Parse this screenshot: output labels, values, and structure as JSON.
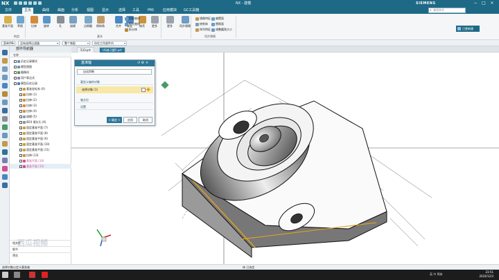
{
  "titlebar": {
    "logo": "NX",
    "title": "NX - 建模",
    "brand": "SIEMENS"
  },
  "menu_tabs": [
    "文件",
    "主页",
    "曲线",
    "曲面",
    "分析",
    "视图",
    "显示",
    "选择",
    "工具",
    "PMI",
    "应用模块",
    "GC工具箱"
  ],
  "search": {
    "placeholder": "查找命令"
  },
  "ribbon": {
    "buttons": [
      {
        "label": "基准平面",
        "color": "#d9b14a"
      },
      {
        "label": "草图",
        "color": "#6fa4cf"
      },
      {
        "label": "拉伸",
        "color": "#d48a3c"
      },
      {
        "label": "旋转",
        "color": "#5b95c8"
      },
      {
        "label": "孔",
        "color": "#8a8f96"
      },
      {
        "label": "拔模",
        "color": "#7a9fc0"
      },
      {
        "label": "边倒圆",
        "color": "#7aa8c8"
      },
      {
        "label": "倒斜角",
        "color": "#c29a6a"
      },
      {
        "label": "合并",
        "color": "#4a86c2"
      },
      {
        "label": "减去",
        "color": "#4a86c2"
      },
      {
        "label": "抽壳",
        "color": "#c9923e"
      },
      {
        "label": "更多",
        "color": "#9aa3ab"
      },
      {
        "label": "更多",
        "color": "#9aa3ab"
      },
      {
        "label": "同步建模",
        "color": "#6e9cc4"
      }
    ],
    "small_items": [
      "投影曲线",
      "相交曲线",
      "拆分体",
      "镜像特征",
      "修剪体",
      "阵列特征",
      "偏置面",
      "替换面",
      "调整圆角大小"
    ],
    "groups": [
      "构造",
      "基本",
      "同步建模"
    ],
    "pin_label": "已更新建"
  },
  "cmdbar": {
    "menu_label": "菜单(M)",
    "filter": "没有选择过滤器",
    "assembly": "整个装配",
    "view": "仅在工作部件内"
  },
  "navigator": {
    "title": "部件导航器",
    "column": "名称",
    "rows": [
      {
        "text": "历史记录模式",
        "icon": "#6b8fb0",
        "indent": 0
      },
      {
        "text": "模型视图",
        "icon": "#6b8fb0",
        "indent": 0
      },
      {
        "text": "摄像机",
        "icon": "#4a9a4a",
        "indent": 0
      },
      {
        "text": "用户表达式",
        "icon": "#9a7ab0",
        "indent": 0
      },
      {
        "text": "模型历史记录",
        "icon": "#4a7fb0",
        "indent": 0
      },
      {
        "text": "基准坐标系 (0)",
        "icon": "#c4a23c",
        "indent": 1
      },
      {
        "text": "拉伸 (1)",
        "icon": "#d48a3c",
        "indent": 1
      },
      {
        "text": "拉伸 (2)",
        "icon": "#d48a3c",
        "indent": 1
      },
      {
        "text": "拉伸 (3)",
        "icon": "#d48a3c",
        "indent": 1
      },
      {
        "text": "拉伸 (4)",
        "icon": "#d48a3c",
        "indent": 1
      },
      {
        "text": "拔模 (5)",
        "icon": "#7a9fc0",
        "indent": 1
      },
      {
        "text": "Ø20 埋头孔 (6)",
        "icon": "#8a8f96",
        "indent": 1
      },
      {
        "text": "固定基准平面 (7)",
        "icon": "#c4a23c",
        "indent": 1
      },
      {
        "text": "固定基准平面 (8)",
        "icon": "#c4a23c",
        "indent": 1
      },
      {
        "text": "固定基准平面 (9)",
        "icon": "#c4a23c",
        "indent": 1
      },
      {
        "text": "固定基准平面 (10)",
        "icon": "#c4a23c",
        "indent": 1
      },
      {
        "text": "固定基准平面 (11)",
        "icon": "#c4a23c",
        "indent": 1
      },
      {
        "text": "拉伸 (13)",
        "icon": "#d48a3c",
        "indent": 1
      },
      {
        "text": "基准平面 (14)",
        "icon": "#d05090",
        "indent": 1,
        "pink": true
      },
      {
        "text": "基准平面 (15)",
        "icon": "#d05090",
        "indent": 1,
        "pink": true
      }
    ],
    "sections": [
      "相关性",
      "细节",
      "预览"
    ]
  },
  "file_tabs": [
    "533.prt",
    "UG练习题5.prt"
  ],
  "dialog": {
    "title": "基准轴",
    "type_value": "自动判断",
    "section_objects": "要定义轴的对象",
    "select_object": "选择对象 (1)",
    "section_direction": "轴方位",
    "section_settings": "设置",
    "btn_ok": "< 确定 >",
    "btn_apply": "应用",
    "btn_cancel": "取消"
  },
  "statusbar": {
    "left": "选择对象以定义基准轴",
    "center": "体 已选定"
  },
  "taskbar": {
    "tray": "英 中",
    "lang": "简体",
    "time": "23:51",
    "date": "2024/12/3"
  },
  "watermark": "西瓜视频"
}
